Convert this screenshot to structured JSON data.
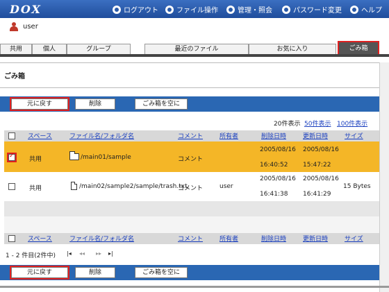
{
  "header": {
    "logo": "DOX",
    "nav": [
      {
        "label": "ログアウト",
        "icon": "logout-icon"
      },
      {
        "label": "ファイル操作",
        "icon": "file-ops-icon"
      },
      {
        "label": "管理・照会",
        "icon": "admin-icon"
      },
      {
        "label": "パスワード変更",
        "icon": "refresh-icon"
      },
      {
        "label": "ヘルプ",
        "icon": "help-icon"
      }
    ]
  },
  "user": {
    "name": "user"
  },
  "tabs": [
    {
      "label": "共用"
    },
    {
      "label": "個人"
    },
    {
      "label": "グループ"
    },
    {
      "label": "最近のファイル"
    },
    {
      "label": "お気に入り"
    },
    {
      "label": "ごみ箱",
      "active": true
    }
  ],
  "page": {
    "title": "ごみ箱"
  },
  "actions": {
    "restore": "元に戻す",
    "delete": "削除",
    "empty": "ごみ箱を空に"
  },
  "pager": {
    "per_page_current": "20件表示",
    "per_page_50": "50件表示",
    "per_page_100": "100件表示",
    "range": "1 - 2 件目(2件中)",
    "first": "|◂",
    "prev": "◂◂",
    "next": "▸▸",
    "last": "▸|"
  },
  "columns": {
    "space": "スペース",
    "name": "ファイル名/フォルダ名",
    "comment": "コメント",
    "owner": "所有者",
    "deleted": "削除日時",
    "updated": "更新日時",
    "size": "サイズ"
  },
  "rows": [
    {
      "checked": true,
      "space": "共用",
      "type": "folder",
      "name": "/main01/sample",
      "comment": "コメント",
      "owner": "",
      "deleted_date": "2005/08/16",
      "deleted_time": "16:40:52",
      "updated_date": "2005/08/16",
      "updated_time": "15:47:22",
      "size": ""
    },
    {
      "checked": false,
      "space": "共用",
      "type": "file",
      "name": "/main02/sample2/sample/trash.txt",
      "comment": "コメント",
      "owner": "user",
      "deleted_date": "2005/08/16",
      "deleted_time": "16:41:38",
      "updated_date": "2005/08/16",
      "updated_time": "16:41:29",
      "size": "15 Bytes"
    }
  ],
  "colors": {
    "header_blue": "#2a5aa8",
    "selected_row": "#f4b627",
    "highlight_red": "#e02020"
  }
}
